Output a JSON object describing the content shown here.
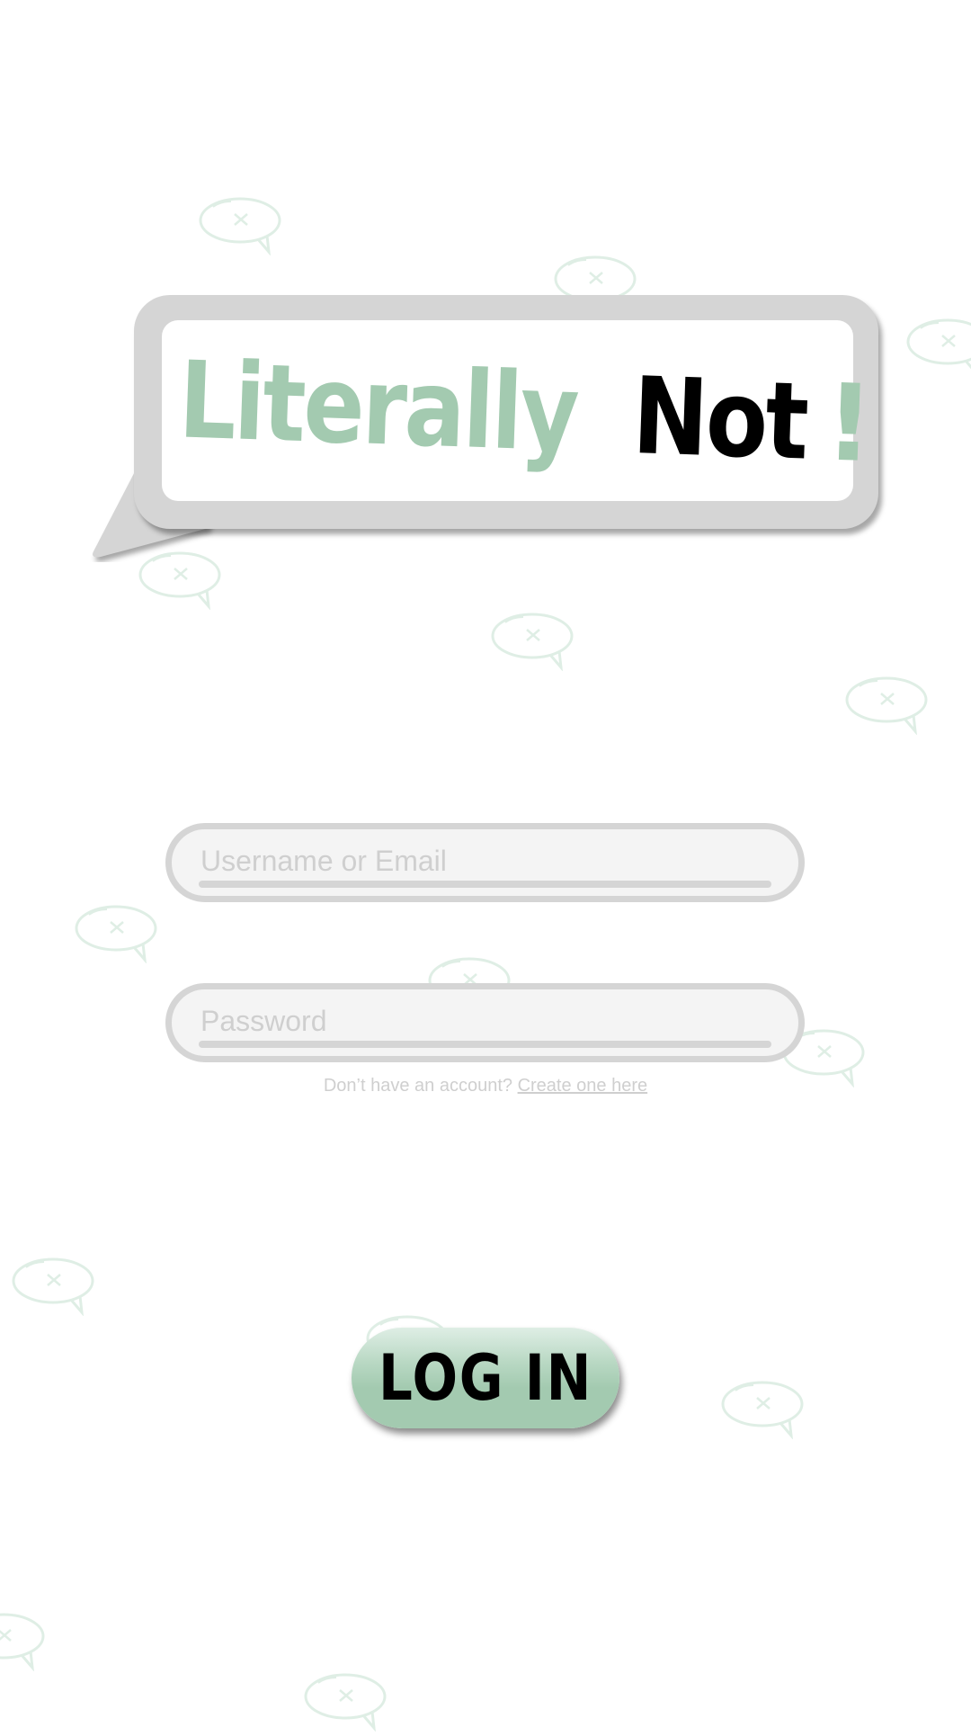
{
  "logo": {
    "word1": "Literally",
    "word2": "Not",
    "punct": "!"
  },
  "colors": {
    "accent": "#a3cab0",
    "frame": "#d5d5d5",
    "placeholder": "#cfcfcf"
  },
  "form": {
    "username": {
      "value": "",
      "placeholder": "Username or Email"
    },
    "password": {
      "value": "",
      "placeholder": "Password"
    },
    "signup_prompt": "Don’t have an account?",
    "signup_link": "Create one here"
  },
  "login_button": {
    "label": "LOG IN"
  },
  "background_icon": "speech-bubble-x-icon"
}
